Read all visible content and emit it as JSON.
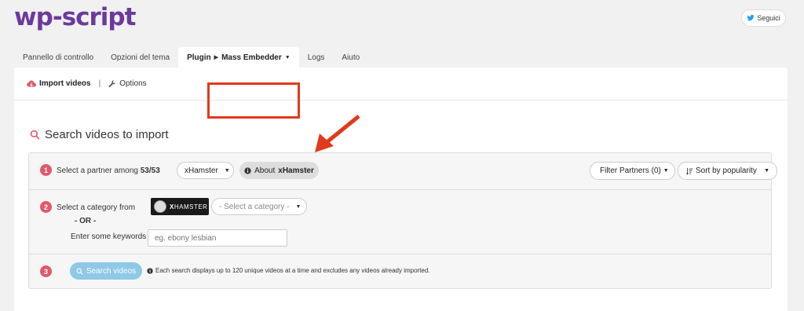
{
  "header": {
    "logo": "wp-script",
    "follow_label": "Seguici"
  },
  "nav": {
    "tabs": [
      {
        "label": "Pannello di controllo"
      },
      {
        "label": "Opzioni del tema"
      },
      {
        "label": "Plugin",
        "sub": "Mass Embedder"
      },
      {
        "label": "Logs"
      },
      {
        "label": "Aiuto"
      }
    ]
  },
  "subnav": {
    "import_label": "Import videos",
    "separator": "|",
    "options_label": "Options"
  },
  "section": {
    "title": "Search videos to import"
  },
  "step1": {
    "number": "1",
    "prefix": "Select a partner among",
    "count": "53/53",
    "partner": "xHamster",
    "about_prefix": "About",
    "about_partner": "xHamster",
    "filter_label": "Filter Partners (0)",
    "sort_label": "Sort by popularity"
  },
  "step2": {
    "number": "2",
    "category_label": "Select a category from",
    "partner_logo_a": "X",
    "partner_logo_b": "HAMSTER",
    "category_placeholder": "- Select a category -",
    "or_label": "- OR -",
    "keywords_label": "Enter some keywords",
    "keywords_placeholder": "eg. ebony lesbian"
  },
  "step3": {
    "number": "3",
    "search_label": "Search videos",
    "note": "Each search displays up to 120 unique videos at a time and excludes any videos already imported."
  },
  "colors": {
    "brand": "#6c3a9c",
    "accent": "#e05a6a",
    "highlight": "#e03a1c",
    "search_button": "#8ec9e6"
  }
}
